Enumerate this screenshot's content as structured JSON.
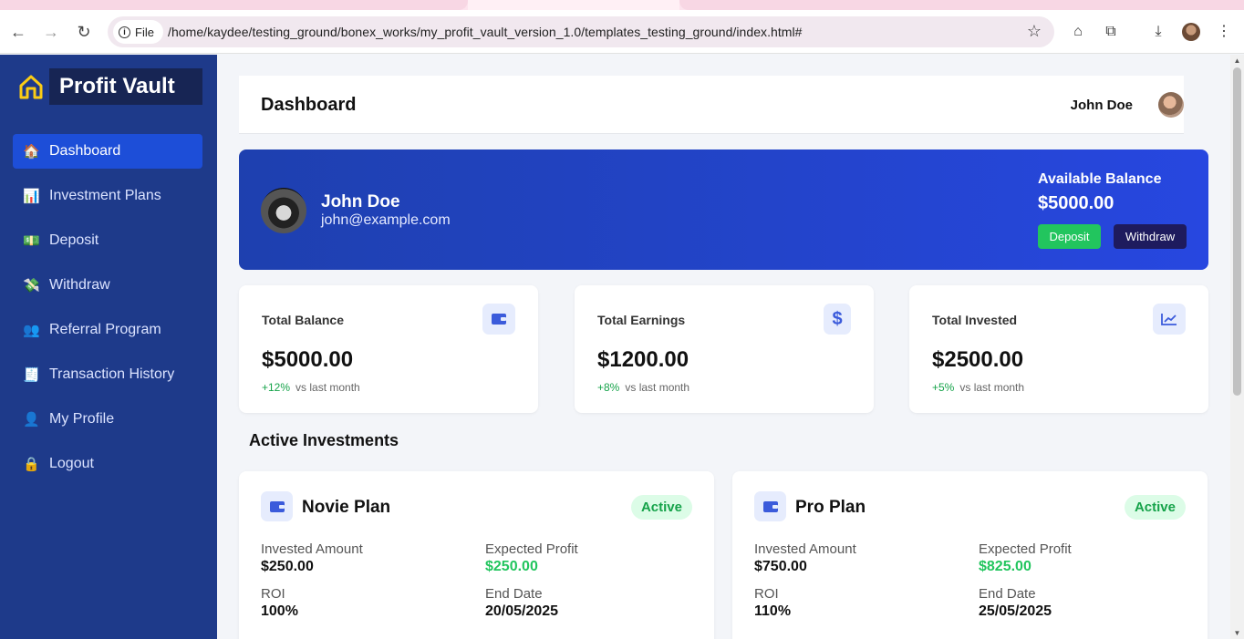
{
  "browser": {
    "site_chip": "File",
    "url": "/home/kaydee/testing_ground/bonex_works/my_profit_vault_version_1.0/templates_testing_ground/index.html#"
  },
  "sidebar": {
    "brand": "Profit Vault",
    "items": [
      {
        "label": "Dashboard",
        "icon": "house-icon",
        "glyph": "🏠"
      },
      {
        "label": "Investment Plans",
        "icon": "chart-icon",
        "glyph": "📊"
      },
      {
        "label": "Deposit",
        "icon": "money-icon",
        "glyph": "💵"
      },
      {
        "label": "Withdraw",
        "icon": "money-wings-icon",
        "glyph": "💸"
      },
      {
        "label": "Referral Program",
        "icon": "users-icon",
        "glyph": "👥"
      },
      {
        "label": "Transaction History",
        "icon": "receipt-icon",
        "glyph": "🧾"
      },
      {
        "label": "My Profile",
        "icon": "user-icon",
        "glyph": "👤"
      },
      {
        "label": "Logout",
        "icon": "lock-icon",
        "glyph": "🔒"
      }
    ]
  },
  "header": {
    "title": "Dashboard",
    "user_name": "John Doe"
  },
  "hero": {
    "name": "John Doe",
    "email": "john@example.com",
    "balance_label": "Available Balance",
    "balance_value": "$5000.00",
    "deposit_label": "Deposit",
    "withdraw_label": "Withdraw"
  },
  "stats": [
    {
      "label": "Total Balance",
      "value": "$5000.00",
      "change": "+12%",
      "note": "vs last month",
      "icon": "wallet-icon"
    },
    {
      "label": "Total Earnings",
      "value": "$1200.00",
      "change": "+8%",
      "note": "vs last month",
      "icon": "dollar-icon"
    },
    {
      "label": "Total Invested",
      "value": "$2500.00",
      "change": "+5%",
      "note": "vs last month",
      "icon": "trend-chart-icon"
    }
  ],
  "investments": {
    "title": "Active Investments",
    "plans": [
      {
        "name": "Novie Plan",
        "status": "Active",
        "invested_label": "Invested Amount",
        "invested": "$250.00",
        "profit_label": "Expected Profit",
        "profit": "$250.00",
        "roi_label": "ROI",
        "roi": "100%",
        "end_label": "End Date",
        "end": "20/05/2025"
      },
      {
        "name": "Pro Plan",
        "status": "Active",
        "invested_label": "Invested Amount",
        "invested": "$750.00",
        "profit_label": "Expected Profit",
        "profit": "$825.00",
        "roi_label": "ROI",
        "roi": "110%",
        "end_label": "End Date",
        "end": "25/05/2025"
      }
    ]
  },
  "colors": {
    "sidebar": "#1e3a8a",
    "accent": "#1d4ed8",
    "positive": "#22c55e"
  }
}
